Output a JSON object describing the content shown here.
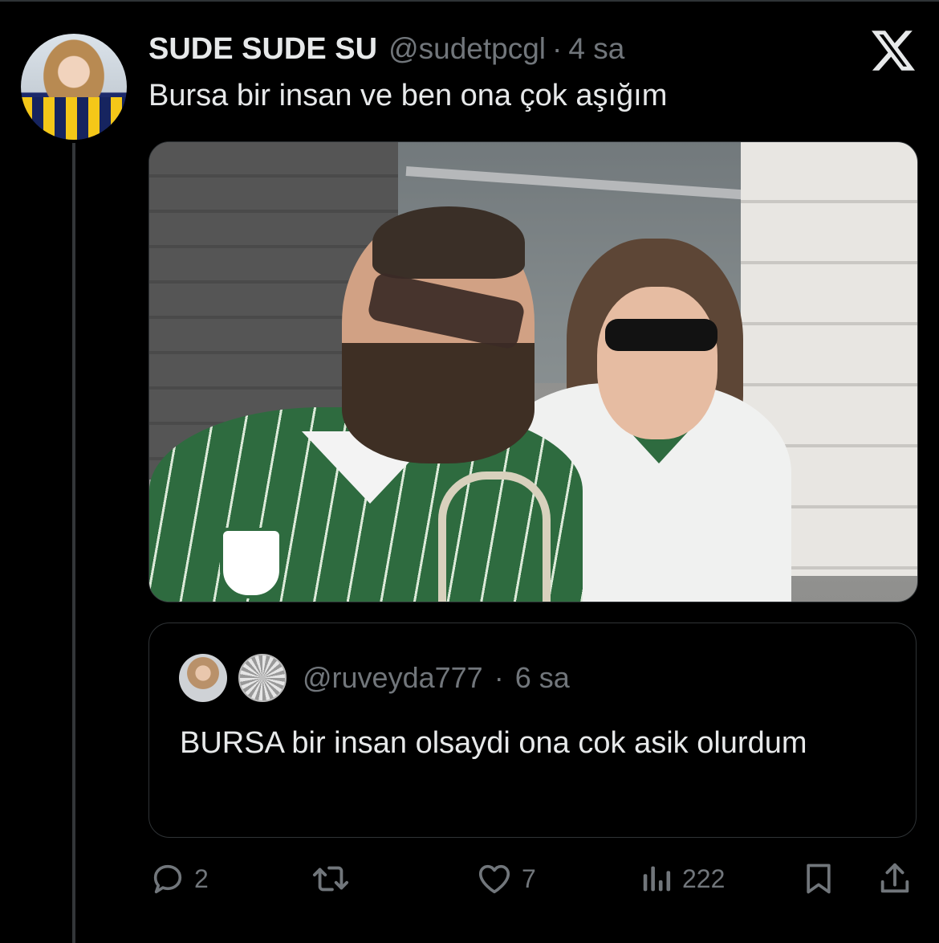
{
  "tweet": {
    "display_name": "SUDE SUDE SU",
    "handle": "@sudetpcgl",
    "separator": "·",
    "time": "4 sa",
    "text": "Bursa bir insan ve ben ona çok aşığım"
  },
  "quoted": {
    "handle": "@ruveyda777",
    "separator": "·",
    "time": "6 sa",
    "text": "BURSA bir insan olsaydi ona cok asik olurdum"
  },
  "actions": {
    "replies": "2",
    "likes": "7",
    "views": "222"
  },
  "icons": {
    "brand": "x-logo",
    "reply": "reply-icon",
    "retweet": "retweet-icon",
    "like": "heart-icon",
    "views": "views-icon",
    "bookmark": "bookmark-icon",
    "share": "share-icon"
  },
  "colors": {
    "background": "#000000",
    "text": "#e7e9ea",
    "muted": "#71767b",
    "border": "#2f3336"
  }
}
